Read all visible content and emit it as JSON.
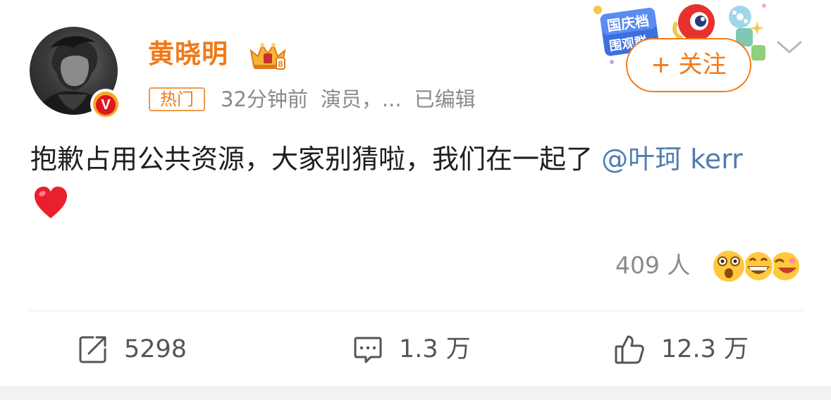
{
  "post": {
    "author": {
      "name": "黄晓明",
      "verified_mark": "V"
    },
    "meta": {
      "tag": "热门",
      "time": "32分钟前",
      "source": "演员，...",
      "edited": "已编辑"
    },
    "follow_label": "+ 关注",
    "festival_badge": "国庆档 围观群众",
    "content": {
      "text": "抱歉占用公共资源，大家别猜啦，我们在一起了",
      "mention": "@叶珂 kerr",
      "emoji": "heart-emoji"
    },
    "reactions": {
      "count_text": "409 人",
      "emojis": [
        "shocked-face-icon",
        "grinning-face-icon",
        "laughing-face-icon"
      ]
    },
    "actions": {
      "repost_count": "5298",
      "comment_count": "1.3 万",
      "like_count": "12.3 万"
    }
  },
  "colors": {
    "accent_orange": "#f07a19",
    "mention_blue": "#4f7db1",
    "meta_gray": "#8a8a8a",
    "text_dark": "#1f1f1f"
  }
}
